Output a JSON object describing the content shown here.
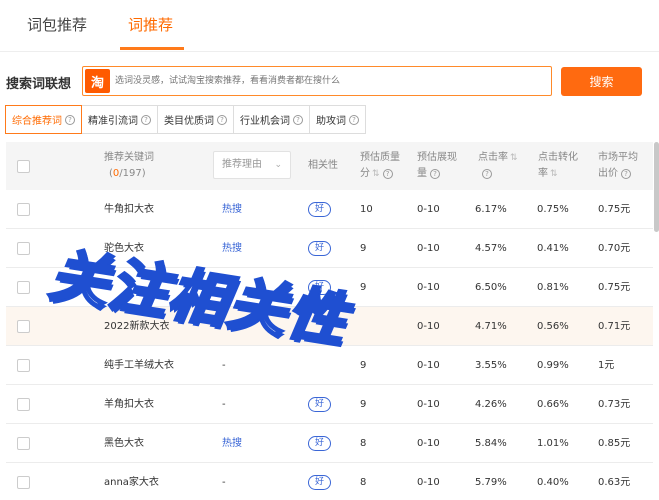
{
  "tabs": [
    {
      "label": "词包推荐"
    },
    {
      "label": "词推荐"
    }
  ],
  "search": {
    "label": "搜索词联想",
    "logo": "淘",
    "placeholder": "选词没灵感，试试淘宝搜索推荐，看看消费者都在搜什么",
    "button": "搜索"
  },
  "filters": [
    {
      "label": "综合推荐词",
      "active": true
    },
    {
      "label": "精准引流词"
    },
    {
      "label": "类目优质词"
    },
    {
      "label": "行业机会词"
    },
    {
      "label": "助攻词"
    }
  ],
  "table": {
    "headers": {
      "keyword_line1": "推荐关键词",
      "keyword_selected": "0",
      "keyword_total": "/197",
      "reason": "推荐理由",
      "relevance": "相关性",
      "quality_line1": "预估质量",
      "quality_line2": "分",
      "impressions_line1": "预估展现",
      "impressions_line2": "量",
      "ctr": "点击率",
      "cvr_line1": "点击转化",
      "cvr_line2": "率",
      "price_line1": "市场平均",
      "price_line2": "出价"
    },
    "rows": [
      {
        "keyword": "牛角扣大衣",
        "reason": "热搜",
        "relevance": "好",
        "quality": "10",
        "impressions": "0-10",
        "ctr": "6.17%",
        "cvr": "0.75%",
        "price": "0.75元"
      },
      {
        "keyword": "驼色大衣",
        "reason": "热搜",
        "relevance": "好",
        "quality": "9",
        "impressions": "0-10",
        "ctr": "4.57%",
        "cvr": "0.41%",
        "price": "0.70元"
      },
      {
        "keyword": "",
        "reason": "",
        "relevance": "好",
        "quality": "9",
        "impressions": "0-10",
        "ctr": "6.50%",
        "cvr": "0.81%",
        "price": "0.75元"
      },
      {
        "keyword": "2022新款大衣",
        "reason": "",
        "relevance": "",
        "quality": "",
        "impressions": "0-10",
        "ctr": "4.71%",
        "cvr": "0.56%",
        "price": "0.71元"
      },
      {
        "keyword": "纯手工羊绒大衣",
        "reason": "-",
        "relevance": "",
        "quality": "9",
        "impressions": "0-10",
        "ctr": "3.55%",
        "cvr": "0.99%",
        "price": "1元"
      },
      {
        "keyword": "羊角扣大衣",
        "reason": "-",
        "relevance": "好",
        "quality": "9",
        "impressions": "0-10",
        "ctr": "4.26%",
        "cvr": "0.66%",
        "price": "0.73元"
      },
      {
        "keyword": "黑色大衣",
        "reason": "热搜",
        "relevance": "好",
        "quality": "8",
        "impressions": "0-10",
        "ctr": "5.84%",
        "cvr": "1.01%",
        "price": "0.85元"
      },
      {
        "keyword": "anna家大衣",
        "reason": "-",
        "relevance": "好",
        "quality": "8",
        "impressions": "0-10",
        "ctr": "5.79%",
        "cvr": "0.40%",
        "price": "0.63元"
      }
    ]
  },
  "overlay": {
    "text": "关注相关性"
  },
  "colors": {
    "accent": "#ff6a00",
    "link": "#3a66d6",
    "overlay_stroke": "#1f4fd1"
  }
}
